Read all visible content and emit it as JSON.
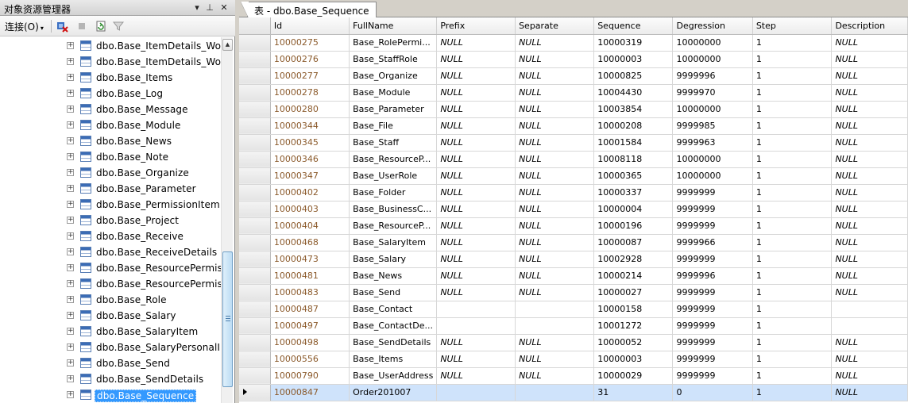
{
  "explorer": {
    "title": "对象资源管理器",
    "controls": {
      "dropdown": "▾",
      "pin": "⊥",
      "close": "✕"
    },
    "toolbar": {
      "connect_label": "连接(O)",
      "connect_arrow": "▾"
    },
    "tree_items": [
      {
        "label": "dbo.Base_ItemDetails_Wor",
        "expander": "+"
      },
      {
        "label": "dbo.Base_ItemDetails_Wor",
        "expander": "+"
      },
      {
        "label": "dbo.Base_Items",
        "expander": "+"
      },
      {
        "label": "dbo.Base_Log",
        "expander": "+"
      },
      {
        "label": "dbo.Base_Message",
        "expander": "+"
      },
      {
        "label": "dbo.Base_Module",
        "expander": "+"
      },
      {
        "label": "dbo.Base_News",
        "expander": "+"
      },
      {
        "label": "dbo.Base_Note",
        "expander": "+"
      },
      {
        "label": "dbo.Base_Organize",
        "expander": "+"
      },
      {
        "label": "dbo.Base_Parameter",
        "expander": "+"
      },
      {
        "label": "dbo.Base_PermissionItem",
        "expander": "+"
      },
      {
        "label": "dbo.Base_Project",
        "expander": "+"
      },
      {
        "label": "dbo.Base_Receive",
        "expander": "+"
      },
      {
        "label": "dbo.Base_ReceiveDetails",
        "expander": "+"
      },
      {
        "label": "dbo.Base_ResourcePermiss",
        "expander": "+"
      },
      {
        "label": "dbo.Base_ResourcePermiss",
        "expander": "+"
      },
      {
        "label": "dbo.Base_Role",
        "expander": "+"
      },
      {
        "label": "dbo.Base_Salary",
        "expander": "+"
      },
      {
        "label": "dbo.Base_SalaryItem",
        "expander": "+"
      },
      {
        "label": "dbo.Base_SalaryPersonalIn",
        "expander": "+"
      },
      {
        "label": "dbo.Base_Send",
        "expander": "+"
      },
      {
        "label": "dbo.Base_SendDetails",
        "expander": "+"
      },
      {
        "label": "dbo.Base_Sequence",
        "expander": "+",
        "selected": true
      }
    ]
  },
  "document": {
    "tab_title": "表 - dbo.Base_Sequence"
  },
  "grid": {
    "columns": [
      "Id",
      "FullName",
      "Prefix",
      "Separate",
      "Sequence",
      "Degression",
      "Step",
      "Description"
    ],
    "rows": [
      [
        "10000275",
        "Base_RolePermi...",
        "NULL",
        "NULL",
        "10000319",
        "10000000",
        "1",
        "NULL"
      ],
      [
        "10000276",
        "Base_StaffRole",
        "NULL",
        "NULL",
        "10000003",
        "10000000",
        "1",
        "NULL"
      ],
      [
        "10000277",
        "Base_Organize",
        "NULL",
        "NULL",
        "10000825",
        "9999996",
        "1",
        "NULL"
      ],
      [
        "10000278",
        "Base_Module",
        "NULL",
        "NULL",
        "10004430",
        "9999970",
        "1",
        "NULL"
      ],
      [
        "10000280",
        "Base_Parameter",
        "NULL",
        "NULL",
        "10003854",
        "10000000",
        "1",
        "NULL"
      ],
      [
        "10000344",
        "Base_File",
        "NULL",
        "NULL",
        "10000208",
        "9999985",
        "1",
        "NULL"
      ],
      [
        "10000345",
        "Base_Staff",
        "NULL",
        "NULL",
        "10001584",
        "9999963",
        "1",
        "NULL"
      ],
      [
        "10000346",
        "Base_ResourceP...",
        "NULL",
        "NULL",
        "10008118",
        "10000000",
        "1",
        "NULL"
      ],
      [
        "10000347",
        "Base_UserRole",
        "NULL",
        "NULL",
        "10000365",
        "10000000",
        "1",
        "NULL"
      ],
      [
        "10000402",
        "Base_Folder",
        "NULL",
        "NULL",
        "10000337",
        "9999999",
        "1",
        "NULL"
      ],
      [
        "10000403",
        "Base_BusinessC...",
        "NULL",
        "NULL",
        "10000004",
        "9999999",
        "1",
        "NULL"
      ],
      [
        "10000404",
        "Base_ResourceP...",
        "NULL",
        "NULL",
        "10000196",
        "9999999",
        "1",
        "NULL"
      ],
      [
        "10000468",
        "Base_SalaryItem",
        "NULL",
        "NULL",
        "10000087",
        "9999966",
        "1",
        "NULL"
      ],
      [
        "10000473",
        "Base_Salary",
        "NULL",
        "NULL",
        "10002928",
        "9999999",
        "1",
        "NULL"
      ],
      [
        "10000481",
        "Base_News",
        "NULL",
        "NULL",
        "10000214",
        "9999996",
        "1",
        "NULL"
      ],
      [
        "10000483",
        "Base_Send",
        "NULL",
        "NULL",
        "10000027",
        "9999999",
        "1",
        "NULL"
      ],
      [
        "10000487",
        "Base_Contact",
        "",
        "",
        "10000158",
        "9999999",
        "1",
        ""
      ],
      [
        "10000497",
        "Base_ContactDe...",
        "",
        "",
        "10001272",
        "9999999",
        "1",
        ""
      ],
      [
        "10000498",
        "Base_SendDetails",
        "NULL",
        "NULL",
        "10000052",
        "9999999",
        "1",
        "NULL"
      ],
      [
        "10000556",
        "Base_Items",
        "NULL",
        "NULL",
        "10000003",
        "9999999",
        "1",
        "NULL"
      ],
      [
        "10000790",
        "Base_UserAddress",
        "NULL",
        "NULL",
        "10000029",
        "9999999",
        "1",
        "NULL"
      ],
      [
        "10000847",
        "Order201007",
        "",
        "",
        "31",
        "0",
        "1",
        "NULL"
      ]
    ],
    "current_row": 21
  },
  "colors": {
    "selection": "#3399ff",
    "current_row": "#cfe3fb",
    "id_text": "#8b5a2b"
  }
}
